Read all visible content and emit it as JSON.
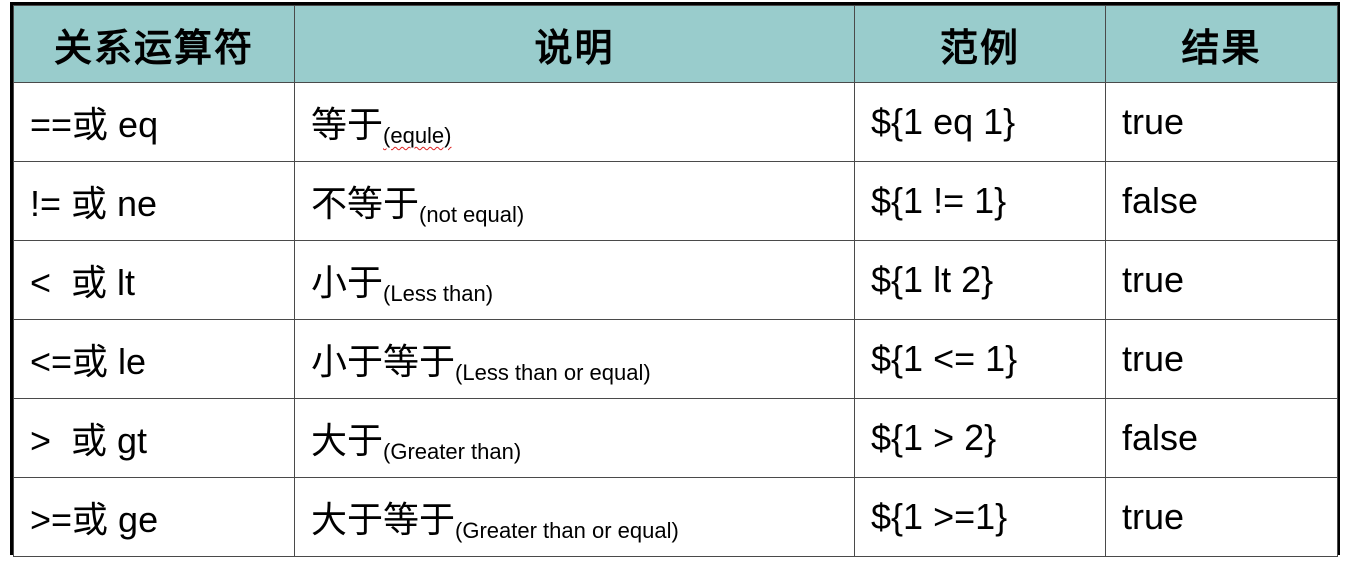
{
  "table": {
    "headers": [
      "关系运算符",
      "说明",
      "范例",
      "结果"
    ],
    "rows": [
      {
        "operator": "==或 eq",
        "desc_cn": "等于",
        "desc_en": "(equle)",
        "example": "${1 eq 1}",
        "result": "true"
      },
      {
        "operator": "!= 或 ne",
        "desc_cn": "不等于",
        "desc_en": "(not equal)",
        "example": "${1 != 1}",
        "result": "false"
      },
      {
        "operator": "<  或 lt",
        "desc_cn": "小于",
        "desc_en": "(Less than)",
        "example": "${1 lt 2}",
        "result": "true"
      },
      {
        "operator": "<=或 le",
        "desc_cn": "小于等于",
        "desc_en": "(Less than or equal)",
        "example": "${1 <= 1}",
        "result": "true"
      },
      {
        "operator": ">  或 gt",
        "desc_cn": "大于",
        "desc_en": "(Greater than)",
        "example": "${1 > 2}",
        "result": "false"
      },
      {
        "operator": ">=或 ge",
        "desc_cn": "大于等于",
        "desc_en": "(Greater than or equal)",
        "example": "${1 >=1}",
        "result": "true"
      }
    ]
  },
  "colors": {
    "header_bg": "#99cccc",
    "border": "#000000",
    "spellcheck_underline": "#dd2222"
  }
}
